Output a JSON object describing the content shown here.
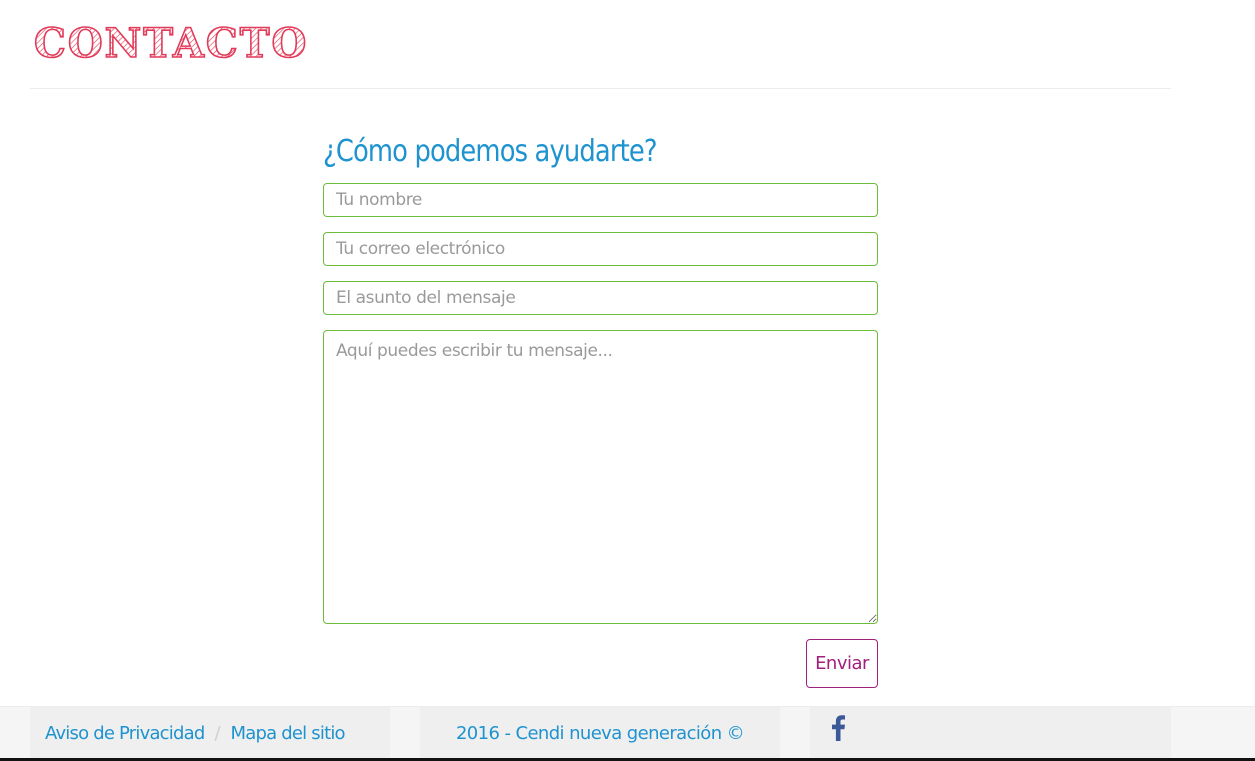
{
  "header": {
    "logo_text": "CONTACTO"
  },
  "form": {
    "title": "¿Cómo podemos ayudarte?",
    "name_placeholder": "Tu nombre",
    "email_placeholder": "Tu correo electrónico",
    "subject_placeholder": "El asunto del mensaje",
    "message_placeholder": "Aquí puedes escribir tu mensaje...",
    "submit_label": "Enviar"
  },
  "footer": {
    "links": [
      {
        "label": "Aviso de Privacidad"
      },
      {
        "label": "Mapa del sitio"
      }
    ],
    "separator": "/",
    "copyright": "2016 - Cendi nueva generación ©",
    "social_icon": "facebook-icon"
  },
  "colors": {
    "title_blue": "#1e93d0",
    "field_border_green": "#6cbd3c",
    "button_purple": "#a0207e",
    "logo_pink": "#e23b5a",
    "facebook_blue": "#3b5998"
  }
}
